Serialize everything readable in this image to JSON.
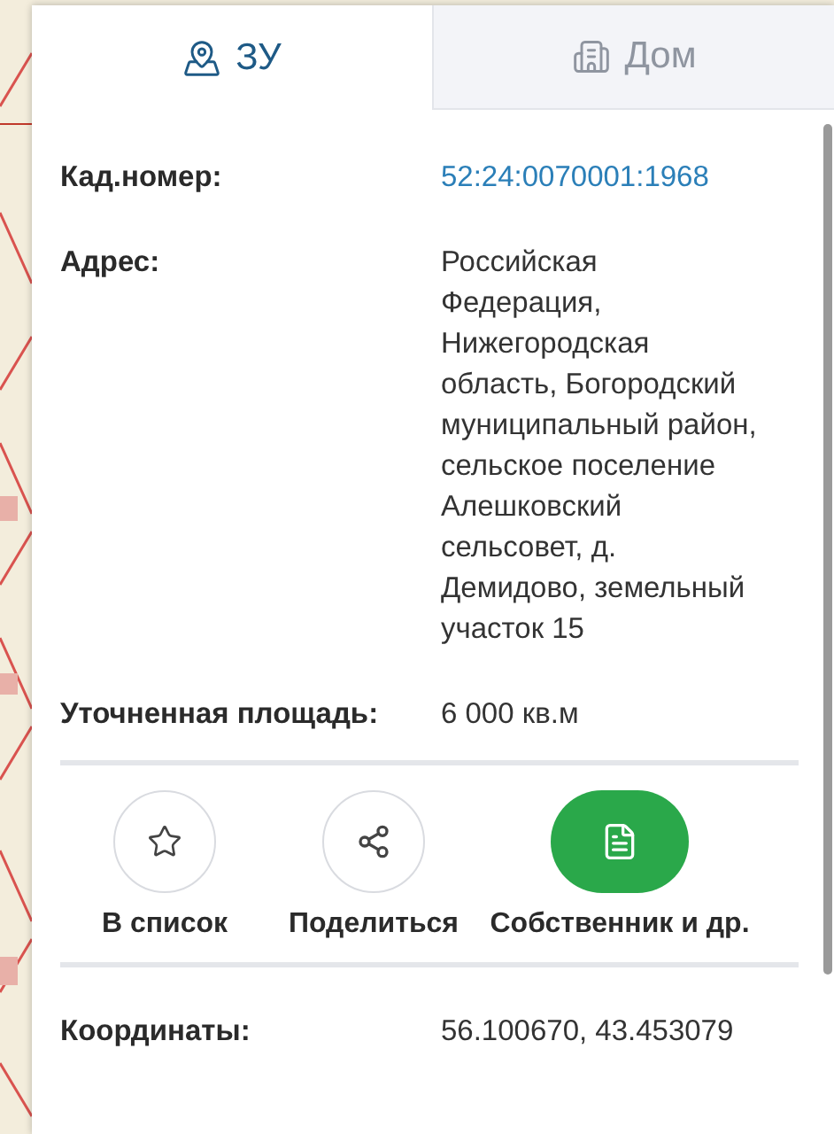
{
  "tabs": [
    {
      "label": "ЗУ",
      "kind": "pin",
      "selected": true
    },
    {
      "label": "Дом",
      "kind": "building",
      "selected": false
    }
  ],
  "fields": [
    {
      "label": "Кад.номер:",
      "value": "52:24:0070001:1968",
      "kind": "link"
    },
    {
      "label": "Адрес:",
      "value": "Российская Федерация, Нижегородская область, Богородский муниципальный район, сельское поселение Алешковский сельсовет, д. Демидово, земельный участок 15",
      "kind": "text"
    },
    {
      "label": "Уточненная площадь:",
      "value": "6 000 кв.м",
      "kind": "text"
    }
  ],
  "actions": [
    {
      "label": "В список",
      "kind": "star",
      "primary": false
    },
    {
      "label": "Поделиться",
      "kind": "share",
      "primary": false
    },
    {
      "label": "Собственник и др.",
      "kind": "document",
      "primary": true
    }
  ],
  "extra_fields": [
    {
      "label": "Координаты:",
      "value": "56.100670, 43.453079"
    }
  ]
}
